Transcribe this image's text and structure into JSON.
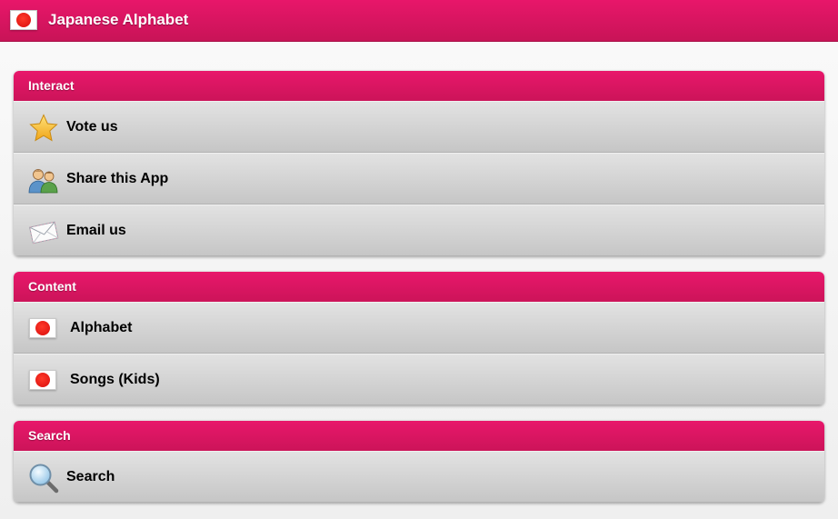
{
  "app": {
    "title": "Japanese Alphabet",
    "flag_icon": "japan-flag-icon"
  },
  "colors": {
    "accent": "#d91562",
    "row_background": "#d0d0d0"
  },
  "sections": [
    {
      "label": "Interact",
      "items": [
        {
          "label": "Vote us",
          "icon": "star-icon"
        },
        {
          "label": "Share this App",
          "icon": "users-icon"
        },
        {
          "label": "Email us",
          "icon": "envelope-icon"
        }
      ]
    },
    {
      "label": "Content",
      "items": [
        {
          "label": "Alphabet",
          "icon": "japan-flag-icon"
        },
        {
          "label": "Songs (Kids)",
          "icon": "japan-flag-icon"
        }
      ]
    },
    {
      "label": "Search",
      "items": [
        {
          "label": "Search",
          "icon": "magnifier-icon"
        }
      ]
    }
  ]
}
